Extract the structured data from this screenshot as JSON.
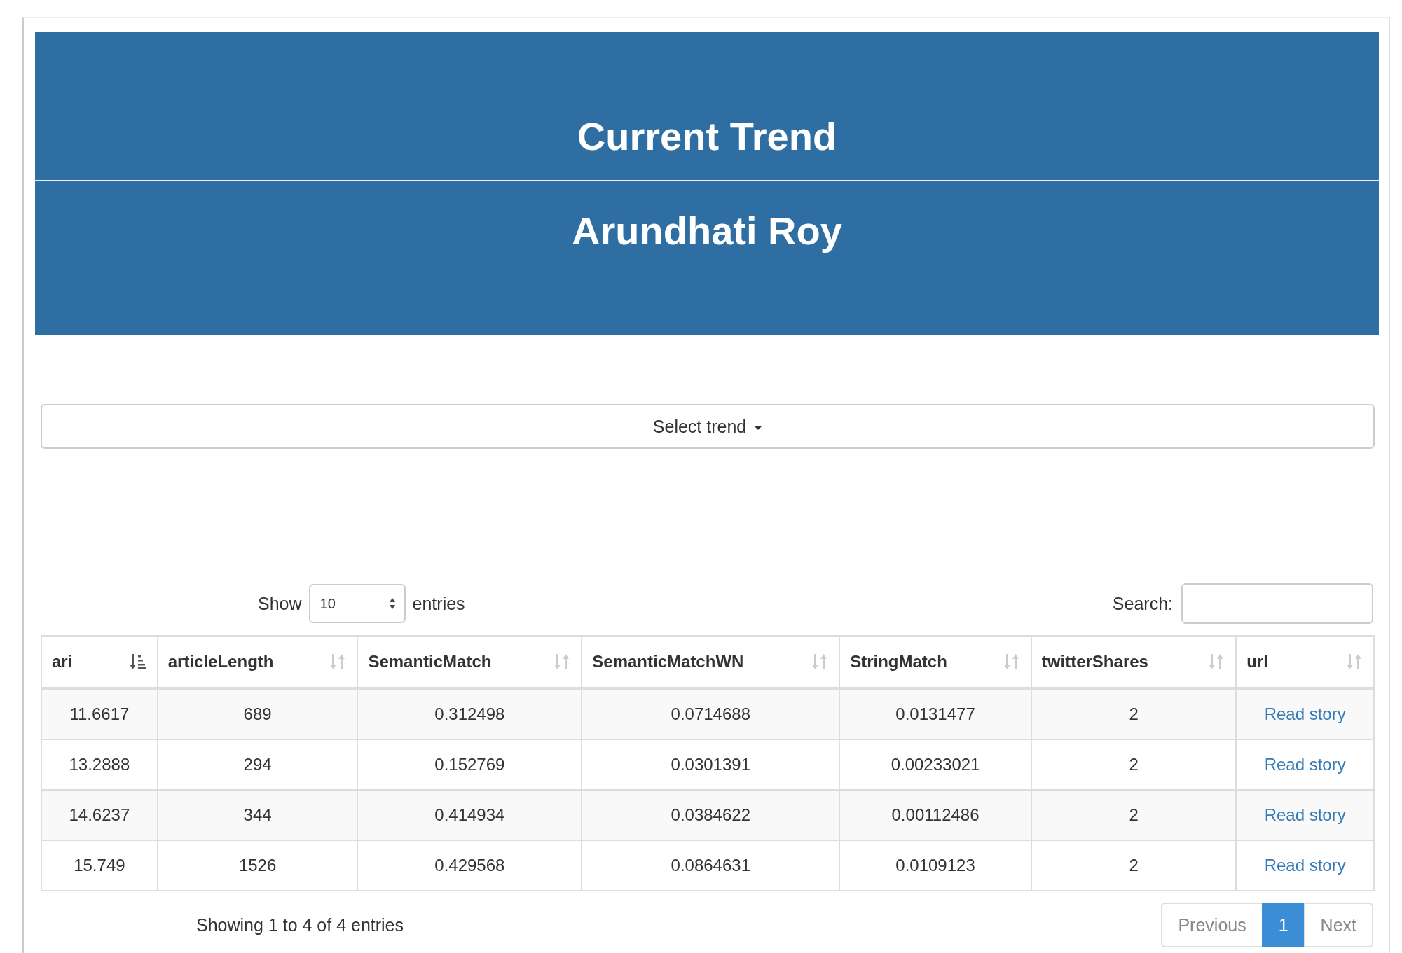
{
  "banner": {
    "title": "Current Trend",
    "subtitle": "Arundhati Roy"
  },
  "trend_dropdown": {
    "label": "Select trend"
  },
  "length_control": {
    "prefix": "Show",
    "value": "10",
    "suffix": "entries"
  },
  "search": {
    "label": "Search:"
  },
  "table": {
    "columns": [
      {
        "label": "ari",
        "sorted": true
      },
      {
        "label": "articleLength",
        "sorted": false
      },
      {
        "label": "SemanticMatch",
        "sorted": false
      },
      {
        "label": "SemanticMatchWN",
        "sorted": false
      },
      {
        "label": "StringMatch",
        "sorted": false
      },
      {
        "label": "twitterShares",
        "sorted": false
      },
      {
        "label": "url",
        "sorted": false
      }
    ],
    "rows": [
      {
        "cells": [
          "11.6617",
          "689",
          "0.312498",
          "0.0714688",
          "0.0131477",
          "2"
        ],
        "link": "Read story"
      },
      {
        "cells": [
          "13.2888",
          "294",
          "0.152769",
          "0.0301391",
          "0.00233021",
          "2"
        ],
        "link": "Read story"
      },
      {
        "cells": [
          "14.6237",
          "344",
          "0.414934",
          "0.0384622",
          "0.00112486",
          "2"
        ],
        "link": "Read story"
      },
      {
        "cells": [
          "15.749",
          "1526",
          "0.429568",
          "0.0864631",
          "0.0109123",
          "2"
        ],
        "link": "Read story"
      }
    ]
  },
  "info": "Showing 1 to 4 of 4 entries",
  "pagination": [
    {
      "label": "Previous",
      "selected": false
    },
    {
      "label": "1",
      "selected": true
    },
    {
      "label": "Next",
      "selected": false
    }
  ]
}
